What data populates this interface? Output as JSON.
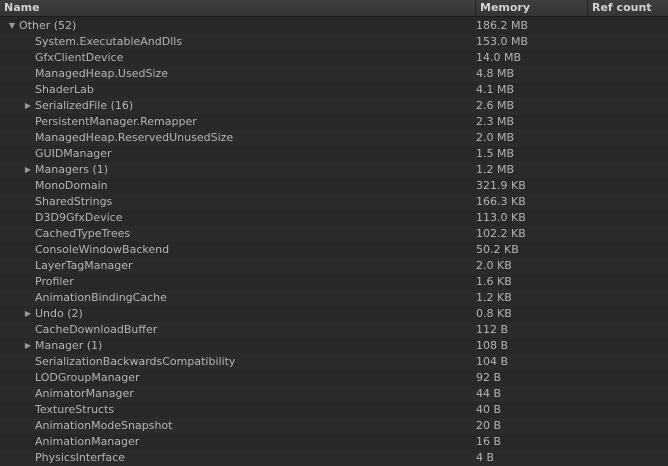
{
  "columns": {
    "name": "Name",
    "memory": "Memory",
    "ref_count": "Ref count"
  },
  "rows": [
    {
      "name": "Other (52)",
      "memory": "186.2 MB",
      "expander": "expanded",
      "level": 0
    },
    {
      "name": "System.ExecutableAndDlls",
      "memory": "153.0 MB",
      "level": 1
    },
    {
      "name": "GfxClientDevice",
      "memory": "14.0 MB",
      "level": 1
    },
    {
      "name": "ManagedHeap.UsedSize",
      "memory": "4.8 MB",
      "level": 1
    },
    {
      "name": "ShaderLab",
      "memory": "4.1 MB",
      "level": 1
    },
    {
      "name": "SerializedFile (16)",
      "memory": "2.6 MB",
      "expander": "collapsed",
      "level": 1
    },
    {
      "name": "PersistentManager.Remapper",
      "memory": "2.3 MB",
      "level": 1
    },
    {
      "name": "ManagedHeap.ReservedUnusedSize",
      "memory": "2.0 MB",
      "level": 1
    },
    {
      "name": "GUIDManager",
      "memory": "1.5 MB",
      "level": 1
    },
    {
      "name": "Managers (1)",
      "memory": "1.2 MB",
      "expander": "collapsed",
      "level": 1
    },
    {
      "name": "MonoDomain",
      "memory": "321.9 KB",
      "level": 1
    },
    {
      "name": "SharedStrings",
      "memory": "166.3 KB",
      "level": 1
    },
    {
      "name": "D3D9GfxDevice",
      "memory": "113.0 KB",
      "level": 1
    },
    {
      "name": "CachedTypeTrees",
      "memory": "102.2 KB",
      "level": 1
    },
    {
      "name": "ConsoleWindowBackend",
      "memory": "50.2 KB",
      "level": 1
    },
    {
      "name": "LayerTagManager",
      "memory": "2.0 KB",
      "level": 1
    },
    {
      "name": "Profiler",
      "memory": "1.6 KB",
      "level": 1
    },
    {
      "name": "AnimationBindingCache",
      "memory": "1.2 KB",
      "level": 1
    },
    {
      "name": "Undo (2)",
      "memory": "0.8 KB",
      "expander": "collapsed",
      "level": 1
    },
    {
      "name": "CacheDownloadBuffer",
      "memory": "112 B",
      "level": 1
    },
    {
      "name": "Manager (1)",
      "memory": "108 B",
      "expander": "collapsed",
      "level": 1
    },
    {
      "name": "SerializationBackwardsCompatibility",
      "memory": "104 B",
      "level": 1
    },
    {
      "name": "LODGroupManager",
      "memory": "92 B",
      "level": 1
    },
    {
      "name": "AnimatorManager",
      "memory": "44 B",
      "level": 1
    },
    {
      "name": "TextureStructs",
      "memory": "40 B",
      "level": 1
    },
    {
      "name": "AnimationModeSnapshot",
      "memory": "20 B",
      "level": 1
    },
    {
      "name": "AnimationManager",
      "memory": "16 B",
      "level": 1
    },
    {
      "name": "PhysicsInterface",
      "memory": "4 B",
      "level": 1
    }
  ],
  "icons": {
    "expanded": "triangle-down-icon",
    "collapsed": "triangle-right-icon"
  },
  "colors": {
    "background": "#282828",
    "text": "#b4b4b4",
    "header_text": "#d2d2d2"
  }
}
